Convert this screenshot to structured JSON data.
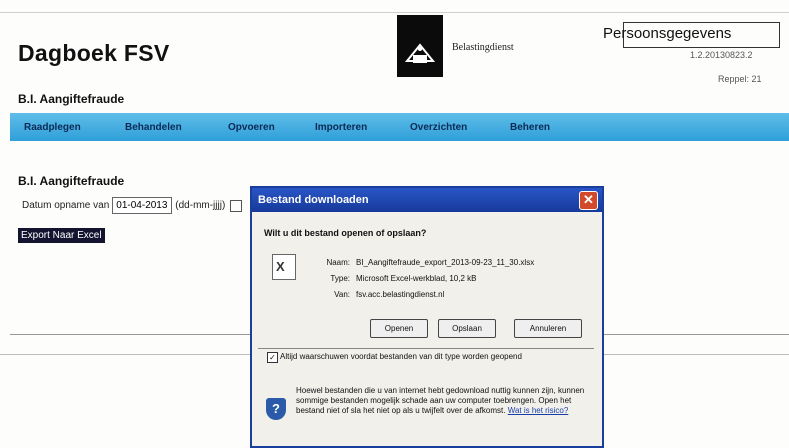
{
  "header": {
    "app_title": "Dagboek FSV",
    "subtitle": "B.I. Aangiftefraude",
    "logo_text": "Belastingdienst",
    "overlay_text": "Persoonsgegevens",
    "version": "1.2.20130823.2",
    "poll": "Reppel: 21"
  },
  "menu": {
    "items": [
      "Raadplegen",
      "Behandelen",
      "Opvoeren",
      "Importeren",
      "Overzichten",
      "Beheren"
    ]
  },
  "page": {
    "section_title": "B.I. Aangiftefraude",
    "date_label": "Datum opname van",
    "date_value": "01-04-2013",
    "date_format": "(dd-mm-jjjj)",
    "export_label": "Export Naar Excel"
  },
  "dialog": {
    "title": "Bestand downloaden",
    "close": "✕",
    "question": "Wilt u dit bestand openen of opslaan?",
    "name_label": "Naam:",
    "name_value": "BI_Aangiftefraude_export_2013-09-23_11_30.xlsx",
    "type_label": "Type:",
    "type_value": "Microsoft Excel-werkblad, 10,2 kB",
    "from_label": "Van:",
    "from_value": "fsv.acc.belastingdienst.nl",
    "open_label": "Openen",
    "save_label": "Opslaan",
    "cancel_label": "Annuleren",
    "checkbox_label": "Altijd waarschuwen voordat bestanden van dit type worden geopend",
    "warning_text": "Hoewel bestanden die u van internet hebt gedownload nuttig kunnen zijn, kunnen sommige bestanden mogelijk schade aan uw computer toebrengen. Open het bestand niet of sla het niet op als u twijfelt over de afkomst.",
    "warning_link": "Wat is het risico?"
  }
}
